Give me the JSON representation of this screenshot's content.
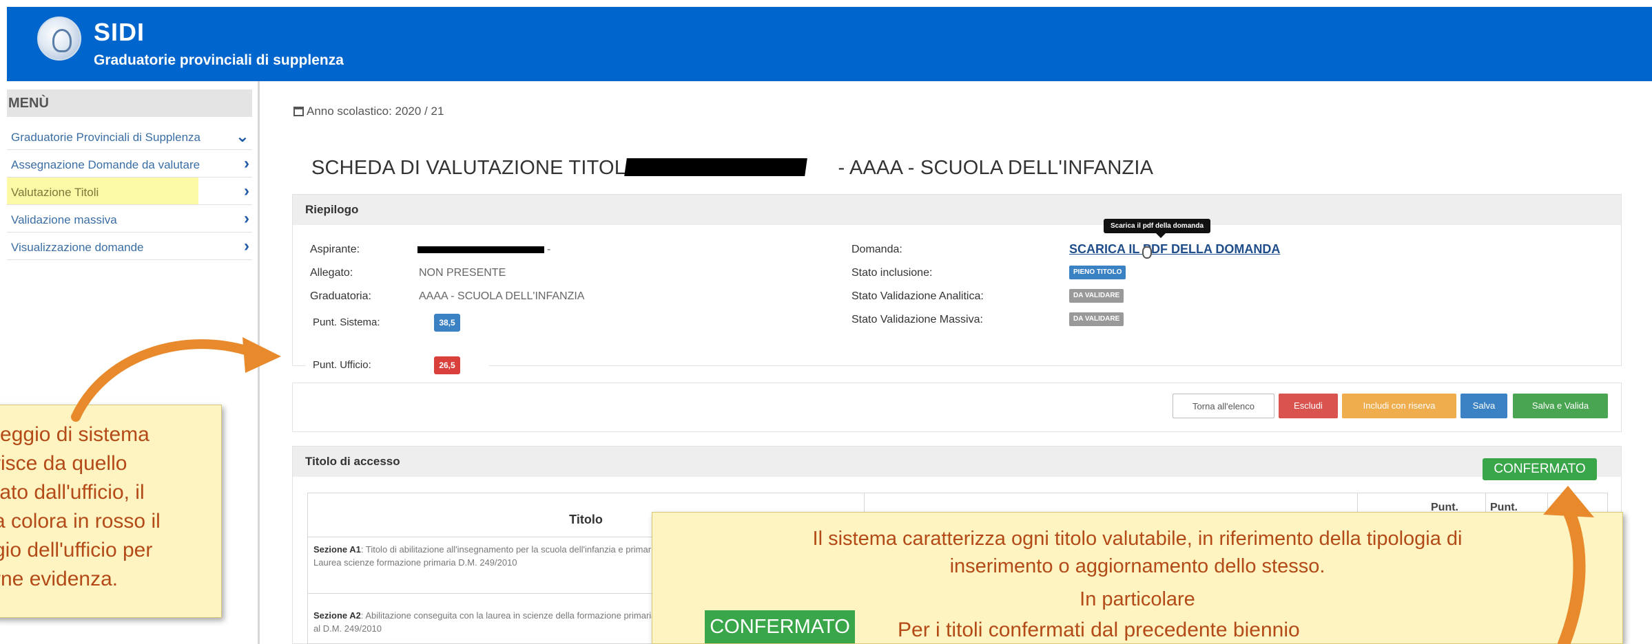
{
  "header": {
    "app_name": "SIDI",
    "subtitle": "Graduatorie provinciali di supplenza"
  },
  "sidebar": {
    "title": "MENÙ",
    "items": [
      {
        "label": "Graduatorie Provinciali di Supplenza",
        "icon": "chevron-down-icon"
      },
      {
        "label": "Assegnazione Domande da valutare",
        "icon": "chevron-right-icon"
      },
      {
        "label": "Valutazione Titoli",
        "icon": "chevron-right-icon",
        "active": true
      },
      {
        "label": "Validazione massiva",
        "icon": "chevron-right-icon"
      },
      {
        "label": "Visualizzazione domande",
        "icon": "chevron-right-icon"
      }
    ]
  },
  "main": {
    "year_label": "Anno scolastico: 2020 / 21",
    "title_prefix": "SCHEDA DI VALUTAZIONE TITOLI -",
    "title_suffix": "- AAAA - SCUOLA DELL'INFANZIA",
    "riepilogo": {
      "heading": "Riepilogo",
      "aspirante_label": "Aspirante:",
      "aspirante_suffix": "-",
      "allegato_label": "Allegato:",
      "allegato_value": "NON PRESENTE",
      "graduatoria_label": "Graduatoria:",
      "graduatoria_value": "AAAA - SCUOLA DELL'INFANZIA",
      "punt_sistema_label": "Punt. Sistema:",
      "punt_sistema_value": "38,5",
      "punt_ufficio_label": "Punt. Ufficio:",
      "punt_ufficio_value": "26,5",
      "domanda_label": "Domanda:",
      "domanda_link": "SCARICA IL PDF DELLA DOMANDA",
      "tooltip": "Scarica il pdf della domanda",
      "stato_inclusione_label": "Stato inclusione:",
      "stato_inclusione_value": "PIENO TITOLO",
      "stato_analitica_label": "Stato Validazione Analitica:",
      "stato_analitica_value": "DA VALIDARE",
      "stato_massiva_label": "Stato Validazione Massiva:",
      "stato_massiva_value": "DA VALIDARE"
    },
    "actions": {
      "back": "Torna all'elenco",
      "exclude": "Escludi",
      "include_reserve": "Includi con riserva",
      "save": "Salva",
      "save_validate": "Salva e Valida"
    },
    "titolo_accesso": {
      "heading": "Titolo di accesso",
      "status_badge": "CONFERMATO",
      "table_headers": {
        "titolo": "Titolo",
        "punt1": "Punt.",
        "punt2": "Punt."
      },
      "rows": [
        {
          "section": "Sezione A1",
          "text": ": Titolo di abilitazione all'insegnamento per la scuola dell'infanzia e primaria - Laurea in scienze della formazione primaria - Laurea scienze formazione primaria D.M. 249/2010"
        },
        {
          "section": "Sezione A2",
          "text": ": Abilitazione conseguita con la laurea in scienze della formazione primaria (scuola dell'infanzia) dell'ordinamento precedente al D.M. 249/2010"
        }
      ]
    }
  },
  "annotations": {
    "left_note": "nteggio di sistema\nrisce da quello\ntato dall'ufficio, il\na colora  in rosso il\ngio dell'ufficio per\nrne evidenza.",
    "big_note_line1": "Il sistema caratterizza ogni titolo valutabile, in riferimento della tipologia di",
    "big_note_line2": "inserimento o aggiornamento  dello stesso.",
    "big_note_line3": "In particolare",
    "big_note_badge": "CONFERMATO",
    "big_note_line4": "Per i titoli confermati dal precedente biennio"
  },
  "colors": {
    "header_blue": "#0065cc",
    "annotation_orange": "#e8892b",
    "annotation_text": "#b34a17",
    "note_bg": "#fdf4c1",
    "confirm_green": "#3aa64a",
    "score_blue": "#3b82c4",
    "score_red": "#d9403c"
  }
}
